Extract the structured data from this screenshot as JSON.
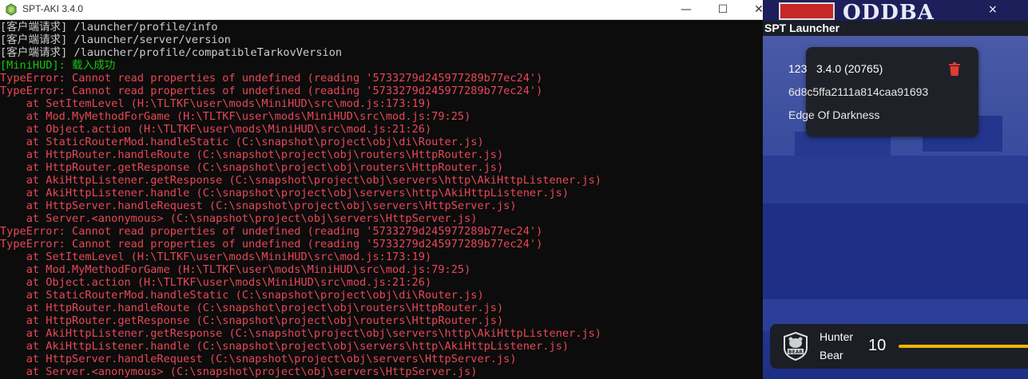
{
  "console": {
    "title": "SPT-AKI 3.4.0",
    "controls": {
      "minimize": "—",
      "maximize": "☐",
      "close": "✕"
    },
    "lines": [
      {
        "text": "[客户端请求] /launcher/profile/info",
        "color": "white"
      },
      {
        "text": "[客户端请求] /launcher/server/version",
        "color": "white"
      },
      {
        "text": "[客户端请求] /launcher/profile/compatibleTarkovVersion",
        "color": "white"
      },
      {
        "text": "[MiniHUD]: 载入成功",
        "color": "green"
      },
      {
        "text": "TypeError: Cannot read properties of undefined (reading '5733279d245977289b77ec24')",
        "color": "red"
      },
      {
        "text": "TypeError: Cannot read properties of undefined (reading '5733279d245977289b77ec24')",
        "color": "red"
      },
      {
        "text": "    at SetItemLevel (H:\\TLTKF\\user\\mods\\MiniHUD\\src\\mod.js:173:19)",
        "color": "red"
      },
      {
        "text": "    at Mod.MyMethodForGame (H:\\TLTKF\\user\\mods\\MiniHUD\\src\\mod.js:79:25)",
        "color": "red"
      },
      {
        "text": "    at Object.action (H:\\TLTKF\\user\\mods\\MiniHUD\\src\\mod.js:21:26)",
        "color": "red"
      },
      {
        "text": "    at StaticRouterMod.handleStatic (C:\\snapshot\\project\\obj\\di\\Router.js)",
        "color": "red"
      },
      {
        "text": "    at HttpRouter.handleRoute (C:\\snapshot\\project\\obj\\routers\\HttpRouter.js)",
        "color": "red"
      },
      {
        "text": "    at HttpRouter.getResponse (C:\\snapshot\\project\\obj\\routers\\HttpRouter.js)",
        "color": "red"
      },
      {
        "text": "    at AkiHttpListener.getResponse (C:\\snapshot\\project\\obj\\servers\\http\\AkiHttpListener.js)",
        "color": "red"
      },
      {
        "text": "    at AkiHttpListener.handle (C:\\snapshot\\project\\obj\\servers\\http\\AkiHttpListener.js)",
        "color": "red"
      },
      {
        "text": "    at HttpServer.handleRequest (C:\\snapshot\\project\\obj\\servers\\HttpServer.js)",
        "color": "red"
      },
      {
        "text": "    at Server.<anonymous> (C:\\snapshot\\project\\obj\\servers\\HttpServer.js)",
        "color": "red"
      },
      {
        "text": "TypeError: Cannot read properties of undefined (reading '5733279d245977289b77ec24')",
        "color": "red"
      },
      {
        "text": "TypeError: Cannot read properties of undefined (reading '5733279d245977289b77ec24')",
        "color": "red"
      },
      {
        "text": "    at SetItemLevel (H:\\TLTKF\\user\\mods\\MiniHUD\\src\\mod.js:173:19)",
        "color": "red"
      },
      {
        "text": "    at Mod.MyMethodForGame (H:\\TLTKF\\user\\mods\\MiniHUD\\src\\mod.js:79:25)",
        "color": "red"
      },
      {
        "text": "    at Object.action (H:\\TLTKF\\user\\mods\\MiniHUD\\src\\mod.js:21:26)",
        "color": "red"
      },
      {
        "text": "    at StaticRouterMod.handleStatic (C:\\snapshot\\project\\obj\\di\\Router.js)",
        "color": "red"
      },
      {
        "text": "    at HttpRouter.handleRoute (C:\\snapshot\\project\\obj\\routers\\HttpRouter.js)",
        "color": "red"
      },
      {
        "text": "    at HttpRouter.getResponse (C:\\snapshot\\project\\obj\\routers\\HttpRouter.js)",
        "color": "red"
      },
      {
        "text": "    at AkiHttpListener.getResponse (C:\\snapshot\\project\\obj\\servers\\http\\AkiHttpListener.js)",
        "color": "red"
      },
      {
        "text": "    at AkiHttpListener.handle (C:\\snapshot\\project\\obj\\servers\\http\\AkiHttpListener.js)",
        "color": "red"
      },
      {
        "text": "    at HttpServer.handleRequest (C:\\snapshot\\project\\obj\\servers\\HttpServer.js)",
        "color": "red"
      },
      {
        "text": "    at Server.<anonymous> (C:\\snapshot\\project\\obj\\servers\\HttpServer.js)",
        "color": "red"
      }
    ]
  },
  "background": {
    "banner_text": "ODDBA",
    "banner_close": "×"
  },
  "launcher": {
    "title": "SPT Launcher",
    "profile": {
      "username": "123",
      "version": "3.4.0 (20765)",
      "id": "6d8c5ffa2111a814caa91693",
      "edition": "Edge Of Darkness",
      "delete_icon": "trash-icon"
    },
    "player": {
      "nickname": "Hunter",
      "side": "Bear",
      "level": "10",
      "faction_icon": "bear-icon",
      "xp_color": "#f0b400"
    }
  },
  "colors": {
    "console_bg": "#0c0c0c",
    "console_white": "#cccccc",
    "console_green": "#16c60c",
    "console_red": "#e74856",
    "launcher_bg": "#1b1e24",
    "delete_red": "#e53935"
  }
}
